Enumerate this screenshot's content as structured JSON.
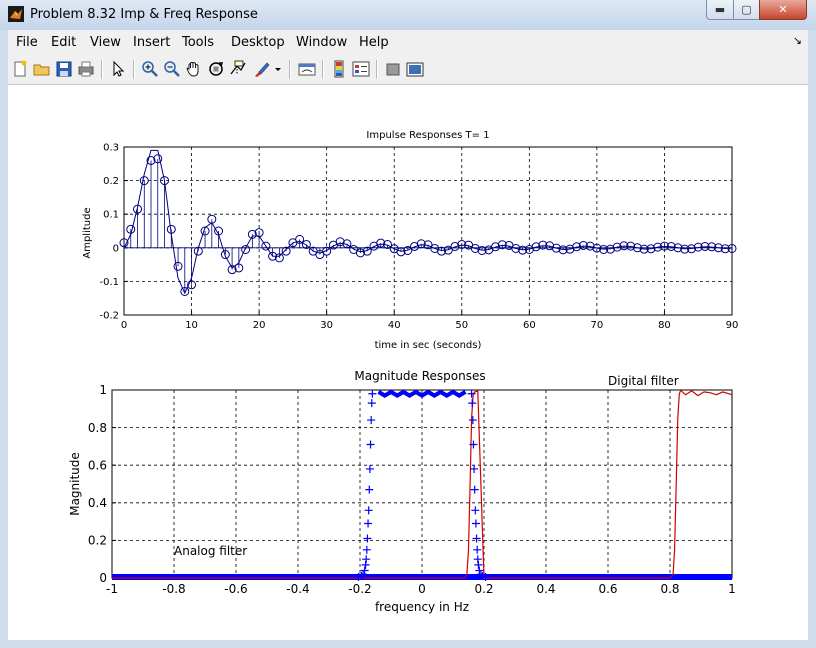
{
  "window": {
    "title": "Problem 8.32 Imp & Freq Response",
    "min_symbol": "▬",
    "max_symbol": "▢",
    "close_symbol": "✕"
  },
  "menu": {
    "items": [
      "File",
      "Edit",
      "View",
      "Insert",
      "Tools",
      "Desktop",
      "Window",
      "Help"
    ],
    "dock_arrow": "↘"
  },
  "toolbar": {
    "icons": [
      "new-figure-icon",
      "open-file-icon",
      "save-icon",
      "print-icon",
      "edit-plot-arrow-icon",
      "zoom-in-icon",
      "zoom-out-icon",
      "pan-hand-icon",
      "rotate-3d-icon",
      "data-cursor-icon",
      "brush-icon",
      "brush-dropdown-icon",
      "link-plot-icon",
      "colorbar-icon",
      "legend-icon",
      "hide-plot-tools-icon",
      "show-plot-tools-icon"
    ]
  },
  "colors": {
    "series_blue": "#0000ff",
    "stem_navy": "#00007f",
    "digital_red": "#d40000",
    "grid": "#000000"
  },
  "chart_data": [
    {
      "type": "scatter",
      "title": "Impulse Responses T= 1",
      "xlabel": "time in sec (seconds)",
      "ylabel": "Amplitude",
      "xlim": [
        0,
        90
      ],
      "ylim": [
        -0.2,
        0.3
      ],
      "xticks": [
        0,
        10,
        20,
        30,
        40,
        50,
        60,
        70,
        80,
        90
      ],
      "yticks": [
        -0.2,
        -0.1,
        0,
        0.1,
        0.2,
        0.3
      ],
      "xtick_labels": [
        "0",
        "10",
        "20",
        "30",
        "40",
        "50",
        "60",
        "70",
        "80",
        "90"
      ],
      "ytick_labels": [
        "-0.2",
        "-0.1",
        "0",
        "0.1",
        "0.2",
        "0.3"
      ],
      "grid": true,
      "series": [
        {
          "style": "stem-circle",
          "x": [
            0,
            1,
            2,
            3,
            4,
            5,
            6,
            7,
            8,
            9,
            10,
            11,
            12,
            13,
            14,
            15,
            16,
            17,
            18,
            19,
            20,
            21,
            22,
            23,
            24,
            25,
            26,
            27,
            28,
            29,
            30,
            31,
            32,
            33,
            34,
            35,
            36,
            37,
            38,
            39,
            40,
            41,
            42,
            43,
            44,
            45,
            46,
            47,
            48,
            49,
            50,
            51,
            52,
            53,
            54,
            55,
            56,
            57,
            58,
            59,
            60,
            61,
            62,
            63,
            64,
            65,
            66,
            67,
            68,
            69,
            70,
            71,
            72,
            73,
            74,
            75,
            76,
            77,
            78,
            79,
            80,
            81,
            82,
            83,
            84,
            85,
            86,
            87,
            88,
            89,
            90
          ],
          "y": [
            0.015,
            0.055,
            0.115,
            0.2,
            0.26,
            0.265,
            0.2,
            0.055,
            -0.055,
            -0.13,
            -0.11,
            -0.01,
            0.05,
            0.085,
            0.05,
            -0.02,
            -0.065,
            -0.06,
            -0.005,
            0.04,
            0.045,
            0.005,
            -0.025,
            -0.03,
            -0.01,
            0.015,
            0.025,
            0.01,
            -0.01,
            -0.02,
            -0.01,
            0.008,
            0.018,
            0.012,
            -0.005,
            -0.015,
            -0.01,
            0.005,
            0.014,
            0.01,
            -0.003,
            -0.012,
            -0.008,
            0.004,
            0.012,
            0.009,
            -0.002,
            -0.01,
            -0.007,
            0.004,
            0.01,
            0.008,
            -0.002,
            -0.008,
            -0.006,
            0.003,
            0.009,
            0.007,
            -0.002,
            -0.007,
            -0.005,
            0.003,
            0.008,
            0.006,
            -0.001,
            -0.006,
            -0.004,
            0.003,
            0.007,
            0.005,
            -0.001,
            -0.005,
            -0.004,
            0.002,
            0.006,
            0.005,
            0,
            -0.004,
            -0.003,
            0.002,
            0.005,
            0.004,
            0,
            -0.004,
            -0.003,
            0.002,
            0.004,
            0.003,
            0,
            -0.003,
            -0.002
          ]
        },
        {
          "style": "line",
          "x": [
            0,
            1,
            2,
            3,
            4,
            5,
            6,
            7,
            8,
            9,
            10,
            11,
            12,
            13,
            14,
            15,
            16,
            17,
            18,
            19,
            20,
            21,
            22,
            23,
            24,
            25,
            26,
            27,
            28,
            29,
            30,
            31,
            32,
            33,
            34,
            35,
            36,
            37,
            38,
            39,
            40,
            41,
            42,
            43,
            44,
            45,
            46,
            47,
            48,
            49,
            50,
            51,
            52,
            53,
            54,
            55,
            56,
            57,
            58,
            59,
            60,
            61,
            62,
            63,
            64,
            65,
            66,
            67,
            68,
            69,
            70,
            71,
            72,
            73,
            74,
            75,
            76,
            77,
            78,
            79,
            80,
            81,
            82,
            83,
            84,
            85,
            86,
            87,
            88,
            89,
            90
          ],
          "y": [
            0,
            0.04,
            0.12,
            0.22,
            0.29,
            0.29,
            0.2,
            0.04,
            -0.09,
            -0.135,
            -0.09,
            0.0,
            0.06,
            0.075,
            0.04,
            -0.025,
            -0.06,
            -0.045,
            0.0,
            0.035,
            0.035,
            0.005,
            -0.025,
            -0.025,
            -0.005,
            0.015,
            0.02,
            0.008,
            -0.01,
            -0.016,
            -0.008,
            0.006,
            0.014,
            0.01,
            -0.004,
            -0.012,
            -0.008,
            0.004,
            0.011,
            0.008,
            -0.003,
            -0.01,
            -0.007,
            0.003,
            0.009,
            0.007,
            -0.002,
            -0.008,
            -0.006,
            0.003,
            0.008,
            0.006,
            -0.002,
            -0.007,
            -0.005,
            0.002,
            0.007,
            0.005,
            -0.002,
            -0.006,
            -0.004,
            0.002,
            0.006,
            0.005,
            -0.001,
            -0.005,
            -0.004,
            0.002,
            0.005,
            0.004,
            -0.001,
            -0.004,
            -0.003,
            0.002,
            0.005,
            0.004,
            0,
            -0.004,
            -0.003,
            0.002,
            0.004,
            0.003,
            0,
            -0.003,
            -0.002,
            0.001,
            0.003,
            0.002,
            0,
            -0.002,
            -0.001
          ]
        }
      ]
    },
    {
      "type": "line",
      "title": "Magnitude Responses",
      "xlabel": "frequency in Hz",
      "ylabel": "Magnitude",
      "xlim": [
        -1,
        1
      ],
      "ylim": [
        0,
        1
      ],
      "xticks": [
        -1,
        -0.8,
        -0.6,
        -0.4,
        -0.2,
        0,
        0.2,
        0.4,
        0.6,
        0.8,
        1
      ],
      "yticks": [
        0,
        0.2,
        0.4,
        0.6,
        0.8,
        1
      ],
      "xtick_labels": [
        "-1",
        "-0.8",
        "-0.6",
        "-0.4",
        "-0.2",
        "0",
        "0.2",
        "0.4",
        "0.6",
        "0.8",
        "1"
      ],
      "ytick_labels": [
        "0",
        "0.2",
        "0.4",
        "0.6",
        "0.8",
        "1"
      ],
      "grid": true,
      "annotations": [
        "Analog filter",
        "Digital filter"
      ],
      "series": [
        {
          "style": "plus-markers",
          "x": [
            -0.205,
            -0.195,
            -0.19,
            -0.185,
            -0.182,
            -0.18,
            -0.178,
            -0.176,
            -0.174,
            -0.172,
            -0.17,
            -0.168,
            -0.166,
            -0.164,
            -0.162,
            -0.16,
            0.16,
            0.162,
            0.164,
            0.166,
            0.168,
            0.17,
            0.172,
            0.174,
            0.176,
            0.178,
            0.18,
            0.182,
            0.185,
            0.19,
            0.195,
            0.205
          ],
          "y": [
            0.005,
            0.01,
            0.02,
            0.04,
            0.07,
            0.1,
            0.15,
            0.21,
            0.29,
            0.36,
            0.47,
            0.58,
            0.71,
            0.84,
            0.93,
            0.98,
            0.98,
            0.93,
            0.84,
            0.71,
            0.58,
            0.47,
            0.36,
            0.29,
            0.21,
            0.15,
            0.1,
            0.07,
            0.04,
            0.02,
            0.01,
            0.005
          ]
        },
        {
          "style": "line",
          "x": [
            -1,
            0.13,
            0.14,
            0.145,
            0.15,
            0.155,
            0.16,
            0.165,
            0.17,
            0.18,
            0.2,
            0.5,
            0.8,
            0.81,
            0.815,
            0.82,
            0.825,
            0.83,
            0.835,
            0.84,
            0.85,
            0.87,
            0.89,
            0.91,
            0.93,
            0.95,
            0.97,
            1.0
          ],
          "y": [
            0,
            0,
            0,
            0.02,
            0.15,
            0.5,
            0.85,
            0.98,
            0.99,
            0.995,
            0.0,
            0.0,
            0.0,
            0.02,
            0.15,
            0.5,
            0.85,
            0.98,
            1.0,
            0.99,
            0.975,
            0.995,
            0.97,
            0.99,
            0.985,
            0.975,
            0.99,
            0.975
          ],
          "note_band": [
            0.135,
            0.835
          ]
        },
        {
          "style": "line",
          "x": [
            -0.14,
            -0.12,
            -0.1,
            -0.08,
            -0.06,
            -0.04,
            -0.02,
            0.0,
            0.02,
            0.04,
            0.06,
            0.08,
            0.1,
            0.12,
            0.14
          ],
          "y": [
            0.99,
            0.97,
            0.99,
            0.97,
            0.99,
            0.97,
            0.99,
            0.97,
            0.99,
            0.97,
            0.99,
            0.97,
            0.99,
            0.97,
            0.99
          ]
        }
      ]
    }
  ]
}
